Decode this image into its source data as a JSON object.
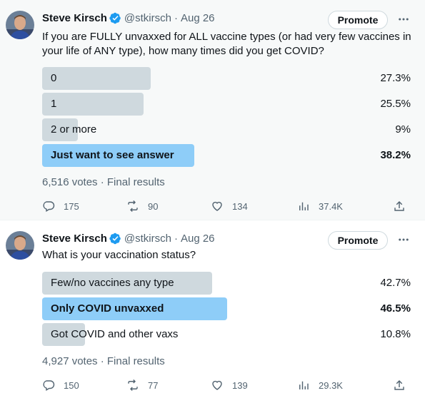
{
  "colors": {
    "accent": "#1d9bf0",
    "winner_bar": "#8ecdf8",
    "bar": "#cfd9de",
    "secondary_text": "#536471"
  },
  "tweets": [
    {
      "author": {
        "name": "Steve Kirsch",
        "handle": "@stkirsch",
        "date": "Aug 26",
        "separator": "·",
        "verified": true
      },
      "promote_label": "Promote",
      "text": "If you are FULLY unvaxxed for ALL vaccine types (or had very few vaccines in your life of ANY type), how many times did you get COVID?",
      "poll": {
        "options": [
          {
            "label": "0",
            "percent": "27.3%",
            "value": 27.3,
            "winner": false
          },
          {
            "label": "1",
            "percent": "25.5%",
            "value": 25.5,
            "winner": false
          },
          {
            "label": "2 or more",
            "percent": "9%",
            "value": 9,
            "winner": false
          },
          {
            "label": "Just want to see answer",
            "percent": "38.2%",
            "value": 38.2,
            "winner": true
          }
        ],
        "summary": "6,516 votes · Final results"
      },
      "stats": {
        "replies": "175",
        "reposts": "90",
        "likes": "134",
        "views": "37.4K"
      }
    },
    {
      "author": {
        "name": "Steve Kirsch",
        "handle": "@stkirsch",
        "date": "Aug 26",
        "separator": "·",
        "verified": true
      },
      "promote_label": "Promote",
      "text": "What is your vaccination status?",
      "poll": {
        "options": [
          {
            "label": "Few/no vaccines any type",
            "percent": "42.7%",
            "value": 42.7,
            "winner": false
          },
          {
            "label": "Only COVID unvaxxed",
            "percent": "46.5%",
            "value": 46.5,
            "winner": true
          },
          {
            "label": "Got COVID and other vaxs",
            "percent": "10.8%",
            "value": 10.8,
            "winner": false
          }
        ],
        "summary": "4,927 votes · Final results"
      },
      "stats": {
        "replies": "150",
        "reposts": "77",
        "likes": "139",
        "views": "29.3K"
      }
    }
  ]
}
